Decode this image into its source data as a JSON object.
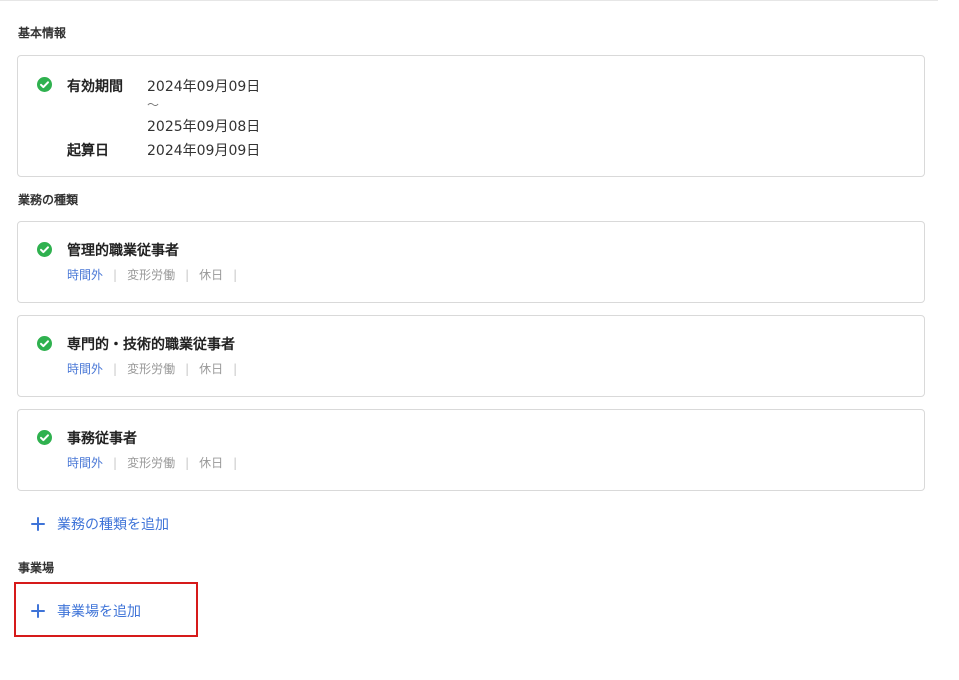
{
  "basic_info": {
    "section_title": "基本情報",
    "validity_label": "有効期間",
    "validity_start": "2024年09月09日",
    "validity_tilde": "～",
    "validity_end": "2025年09月08日",
    "base_date_label": "起算日",
    "base_date_value": "2024年09月09日"
  },
  "job_types": {
    "section_title": "業務の種類",
    "items": [
      {
        "title": "管理的職業従事者",
        "tags": [
          "時間外",
          "変形労働",
          "休日"
        ]
      },
      {
        "title": "専門的・技術的職業従事者",
        "tags": [
          "時間外",
          "変形労働",
          "休日"
        ]
      },
      {
        "title": "事務従事者",
        "tags": [
          "時間外",
          "変形労働",
          "休日"
        ]
      }
    ],
    "add_label": "業務の種類を追加"
  },
  "workplace": {
    "section_title": "事業場",
    "add_label": "事業場を追加"
  },
  "colors": {
    "check_green": "#2fb14f",
    "link_blue": "#3f74d8",
    "highlight_red": "#d61a1a"
  }
}
